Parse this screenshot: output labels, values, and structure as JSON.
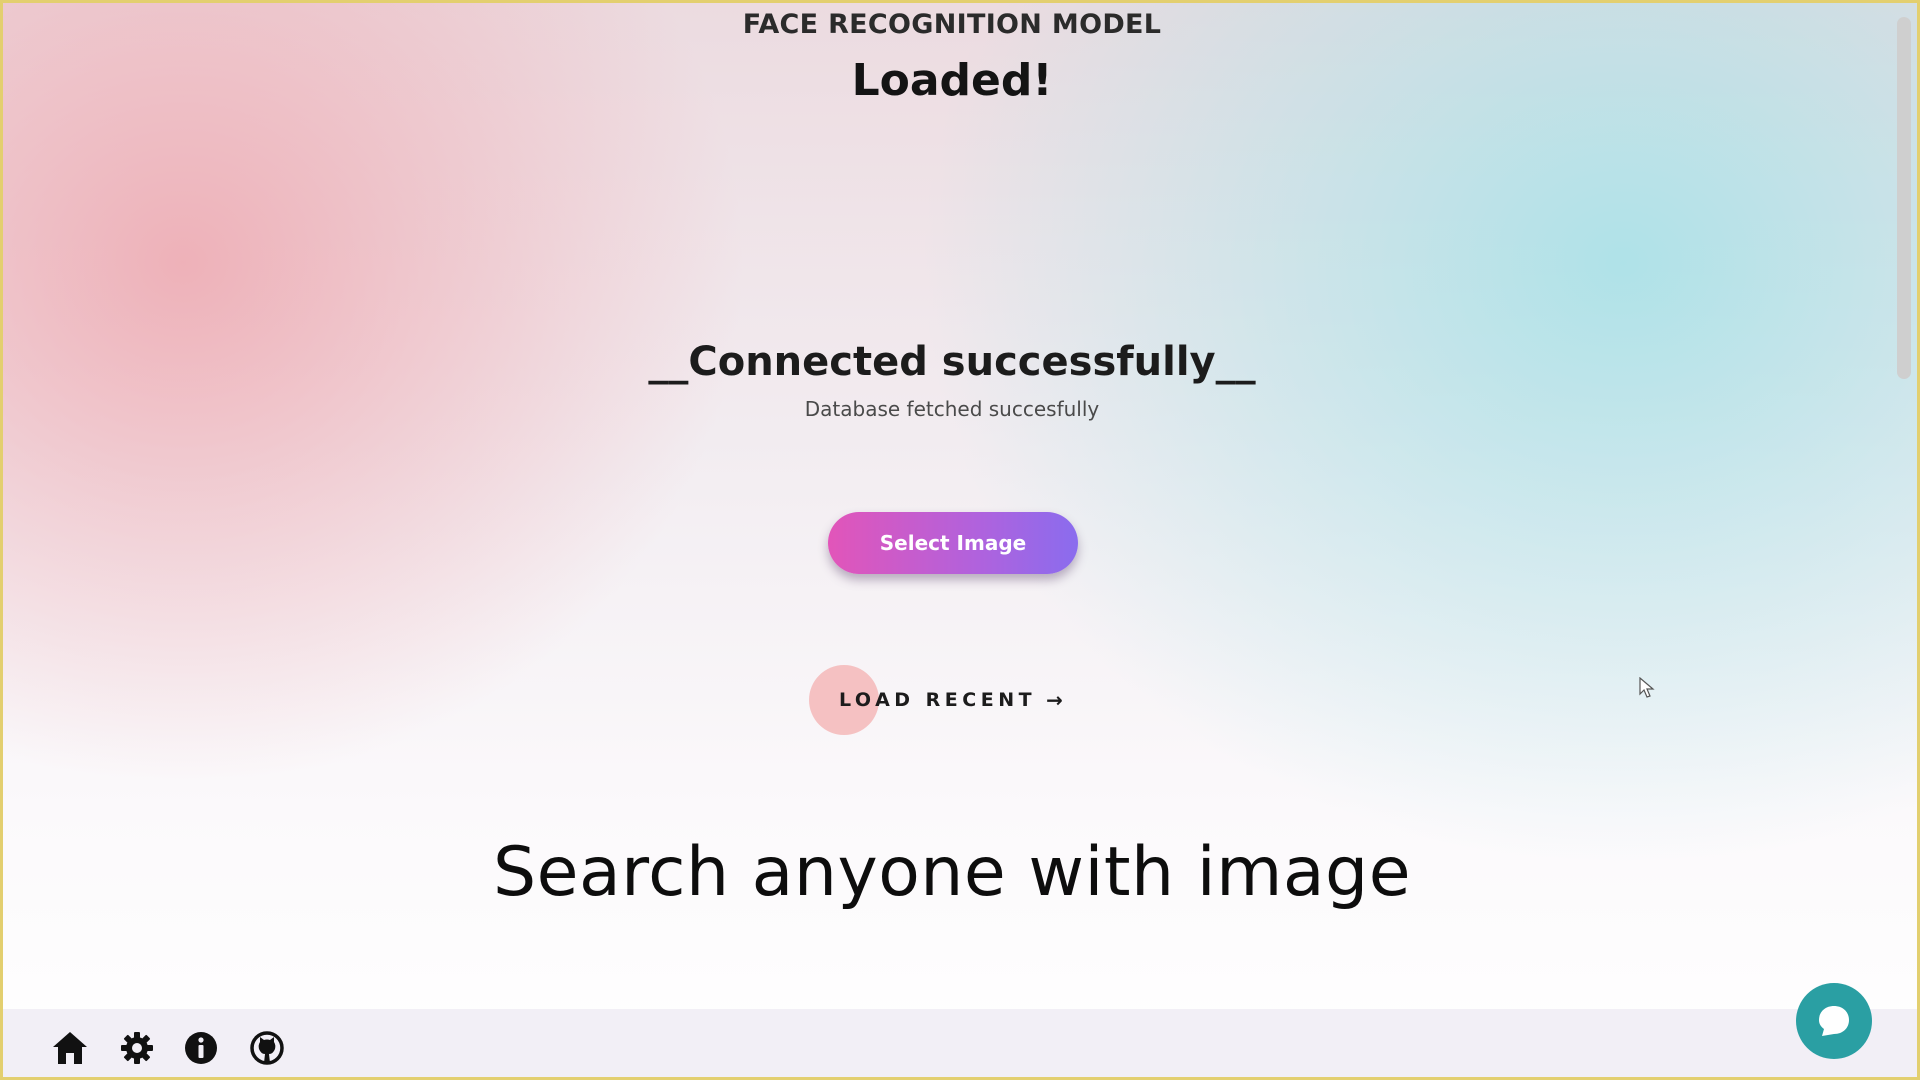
{
  "header": {
    "title": "FACE RECOGNITION MODEL",
    "status": "Loaded!"
  },
  "connection": {
    "title": "__Connected successfully__",
    "subtitle": "Database fetched succesfully"
  },
  "actions": {
    "select_image_label": "Select Image",
    "load_recent_label": "LOAD RECENT",
    "load_recent_arrow": "→"
  },
  "tagline": "Search anyone with image",
  "footer": {
    "icons": [
      "home-icon",
      "gear-icon",
      "info-icon",
      "github-icon"
    ]
  },
  "chat": {
    "icon": "chat-bubble-icon"
  },
  "colors": {
    "button_gradient_start": "#e255b9",
    "button_gradient_end": "#8a6cee",
    "chat_button": "#2a9fa3",
    "frame_border": "#e3cf6f"
  }
}
